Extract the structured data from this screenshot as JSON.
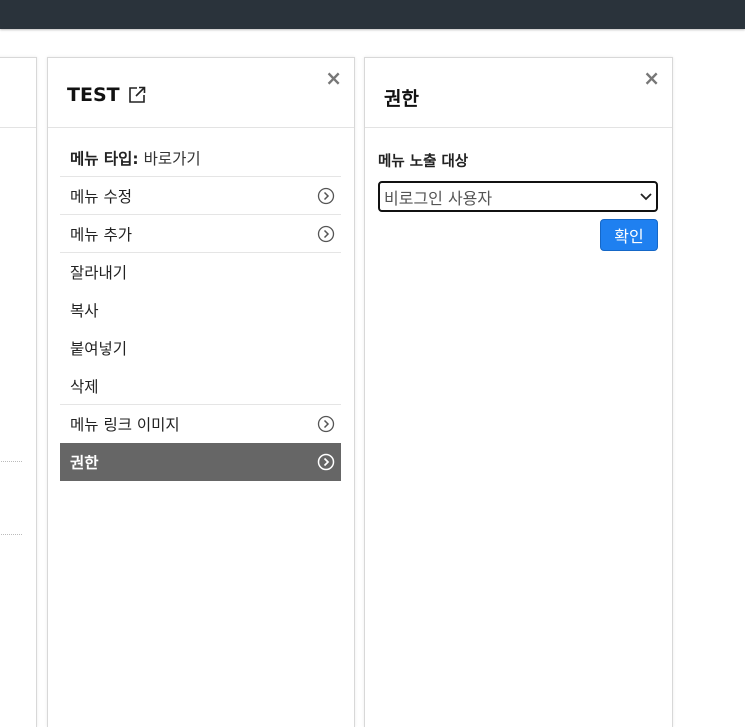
{
  "left_panel": {},
  "menu_panel": {
    "title": "TEST",
    "close": "×",
    "menu_type_label": "메뉴 타입:",
    "menu_type_value": "바로가기",
    "items": [
      {
        "label": "메뉴 수정",
        "chevron": true
      },
      {
        "label": "메뉴 추가",
        "chevron": true
      },
      {
        "label": "잘라내기",
        "chevron": false
      },
      {
        "label": "복사",
        "chevron": false
      },
      {
        "label": "붙여넣기",
        "chevron": false
      },
      {
        "label": "삭제",
        "chevron": false
      },
      {
        "label": "메뉴 링크 이미지",
        "chevron": true
      },
      {
        "label": "권한",
        "chevron": true,
        "active": true
      }
    ]
  },
  "perm_panel": {
    "title": "권한",
    "close": "×",
    "exposure_label": "메뉴 노출 대상",
    "selected_option": "비로그인 사용자",
    "confirm_label": "확인"
  },
  "colors": {
    "topbar": "#2a333b",
    "active_item": "#666666",
    "primary_button": "#1f80f0"
  }
}
